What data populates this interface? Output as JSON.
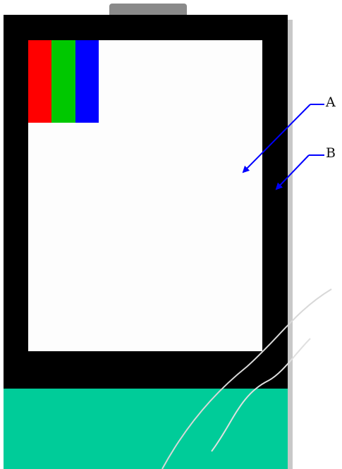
{
  "labels": {
    "a": "A",
    "b": "B"
  },
  "colors": {
    "bezel": "#000000",
    "screen": "#fdfdfd",
    "base": "#00cc99",
    "tab": "#8a8a8a",
    "arrow": "#0000ff",
    "subpixel_red": "#ff0000",
    "subpixel_green": "#00c800",
    "subpixel_blue": "#0000ff"
  },
  "icons": {
    "arrow_a": "arrow-icon",
    "arrow_b": "arrow-icon"
  }
}
